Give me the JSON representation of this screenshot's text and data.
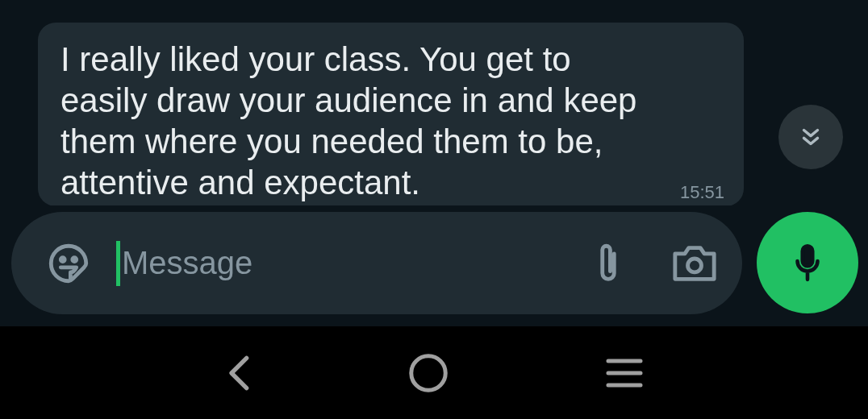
{
  "messages": [
    {
      "text": "I really liked your class. You get to easily draw your audience in and keep them where you needed them to be, attentive and expectant.",
      "time": "15:51"
    }
  ],
  "composer": {
    "placeholder": "Message"
  }
}
